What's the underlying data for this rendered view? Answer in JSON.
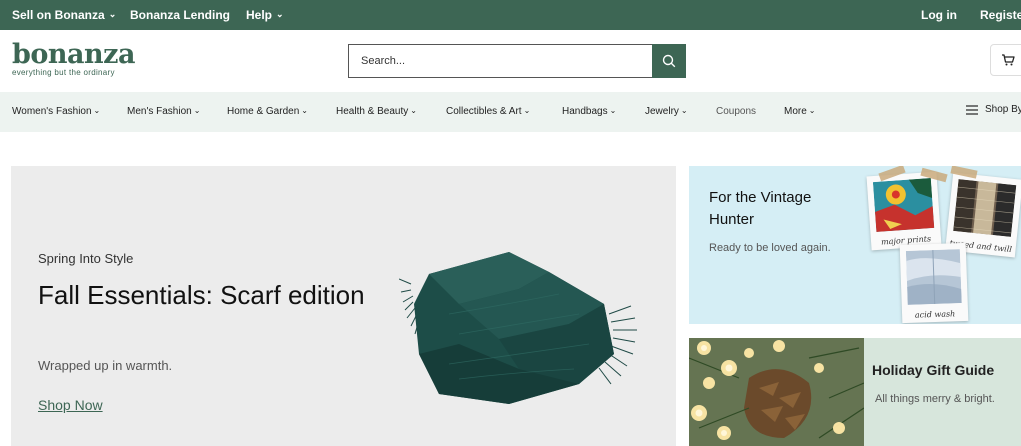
{
  "topbar": {
    "sell": "Sell on Bonanza",
    "lending": "Bonanza Lending",
    "help": "Help",
    "login": "Log in",
    "register": "Register"
  },
  "header": {
    "logo": "bonanza",
    "tagline": "everything but the ordinary",
    "search_placeholder": "Search..."
  },
  "categories": {
    "womens": "Women's Fashion",
    "mens": "Men's Fashion",
    "home": "Home & Garden",
    "health": "Health & Beauty",
    "collectibles": "Collectibles & Art",
    "handbags": "Handbags",
    "jewelry": "Jewelry",
    "coupons": "Coupons",
    "more": "More",
    "shop_by": "Shop By"
  },
  "hero": {
    "kicker": "Spring Into Style",
    "title": "Fall Essentials: Scarf edition",
    "subtitle": "Wrapped up in warmth.",
    "cta": "Shop Now"
  },
  "card_vintage": {
    "title": "For the Vintage Hunter",
    "subtitle": "Ready to be loved again.",
    "photo_labels": [
      "major prints",
      "tweed and twill",
      "acid wash"
    ]
  },
  "card_holiday": {
    "title": "Holiday Gift Guide",
    "subtitle": "All things merry & bright."
  },
  "colors": {
    "brand_green": "#3d6654",
    "nav_bg": "#edf3f0",
    "hero_bg": "#ececec",
    "vintage_bg": "#d5eef5",
    "holiday_bg": "#d7e6dc"
  },
  "icons": {
    "search": "search-icon",
    "cart": "cart-icon",
    "menu": "hamburger-icon",
    "dropdown": "chevron-down-icon"
  }
}
